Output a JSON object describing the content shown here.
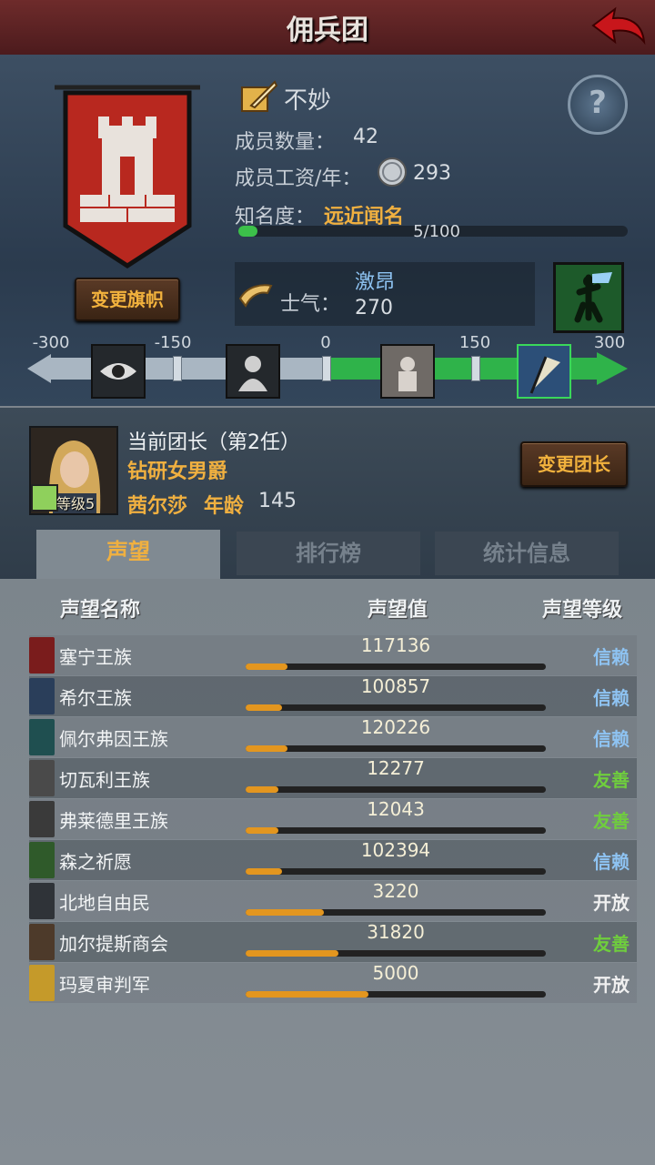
{
  "header": {
    "title": "佣兵团"
  },
  "company": {
    "name": "不妙",
    "members_label": "成员数量：",
    "members": "42",
    "wage_label": "成员工资/年：",
    "wage": "293",
    "fame_label": "知名度：",
    "fame_value": "远近闻名",
    "fame_progress": "5/100",
    "fame_fraction": 0.05,
    "change_flag": "变更旗帜",
    "morale_label": "士气：",
    "morale_state": "激昂",
    "morale_value": "270"
  },
  "morale_scale": {
    "labels": [
      "-300",
      "-150",
      "0",
      "150",
      "300"
    ],
    "current": 270,
    "range": [
      -300,
      300
    ]
  },
  "leader": {
    "title": "当前团长（第2任）",
    "rank": "钻研女男爵",
    "name": "茜尔莎",
    "age_label": "年龄",
    "age": "145",
    "level": "等级5",
    "change_button": "变更团长"
  },
  "tabs": [
    {
      "label": "声望",
      "active": true
    },
    {
      "label": "排行榜",
      "active": false
    },
    {
      "label": "统计信息",
      "active": false
    }
  ],
  "table": {
    "headers": [
      "声望名称",
      "声望值",
      "声望等级"
    ],
    "rows": [
      {
        "name": "塞宁王族",
        "value": "117136",
        "fill": 0.14,
        "level": "信赖",
        "level_color": "#8ec3f2",
        "icon_color": "#7a1c1c"
      },
      {
        "name": "希尔王族",
        "value": "100857",
        "fill": 0.12,
        "level": "信赖",
        "level_color": "#8ec3f2",
        "icon_color": "#2a3e5a"
      },
      {
        "name": "佩尔弗因王族",
        "value": "120226",
        "fill": 0.14,
        "level": "信赖",
        "level_color": "#8ec3f2",
        "icon_color": "#1f4f50"
      },
      {
        "name": "切瓦利王族",
        "value": "12277",
        "fill": 0.11,
        "level": "友善",
        "level_color": "#6fce3d",
        "icon_color": "#4a4a4a"
      },
      {
        "name": "弗莱德里王族",
        "value": "12043",
        "fill": 0.11,
        "level": "友善",
        "level_color": "#6fce3d",
        "icon_color": "#3a3a3a"
      },
      {
        "name": "森之祈愿",
        "value": "102394",
        "fill": 0.12,
        "level": "信赖",
        "level_color": "#8ec3f2",
        "icon_color": "#2f5a2a"
      },
      {
        "name": "北地自由民",
        "value": "3220",
        "fill": 0.26,
        "level": "开放",
        "level_color": "#f0f0f0",
        "icon_color": "#2f3338"
      },
      {
        "name": "加尔提斯商会",
        "value": "31820",
        "fill": 0.31,
        "level": "友善",
        "level_color": "#6fce3d",
        "icon_color": "#4d3a2a"
      },
      {
        "name": "玛夏审判军",
        "value": "5000",
        "fill": 0.41,
        "level": "开放",
        "level_color": "#f0f0f0",
        "icon_color": "#c59a2a"
      }
    ]
  },
  "icons": {
    "back": "back-arrow-icon",
    "help": "question-icon",
    "quill": "quill-icon",
    "coin": "silver-coin-icon",
    "horn": "horn-icon",
    "morale": "victory-banner-icon"
  },
  "colors": {
    "accent": "#f0b040",
    "header": "#5b2224",
    "positive": "#2fb34a"
  }
}
